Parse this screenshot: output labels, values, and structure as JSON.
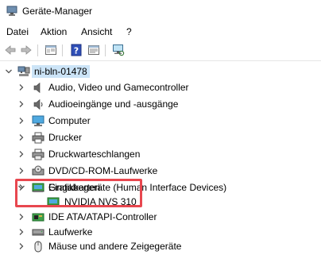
{
  "window": {
    "title": "Geräte-Manager"
  },
  "menu": {
    "items": [
      "Datei",
      "Aktion",
      "Ansicht",
      "?"
    ]
  },
  "tree": {
    "root": "ni-bln-01478",
    "items": [
      "Audio, Video und Gamecontroller",
      "Audioeingänge und -ausgänge",
      "Computer",
      "Drucker",
      "Druckwarteschlangen",
      "DVD/CD-ROM-Laufwerke",
      "Eingabegeräte (Human Interface Devices)",
      "Grafikkarten",
      "NVIDIA NVS 310",
      "IDE ATA/ATAPI-Controller",
      "Laufwerke",
      "Mäuse und andere Zeigegeräte"
    ]
  },
  "colors": {
    "highlight_border": "#e8474f",
    "selection": "#cce4f7"
  }
}
